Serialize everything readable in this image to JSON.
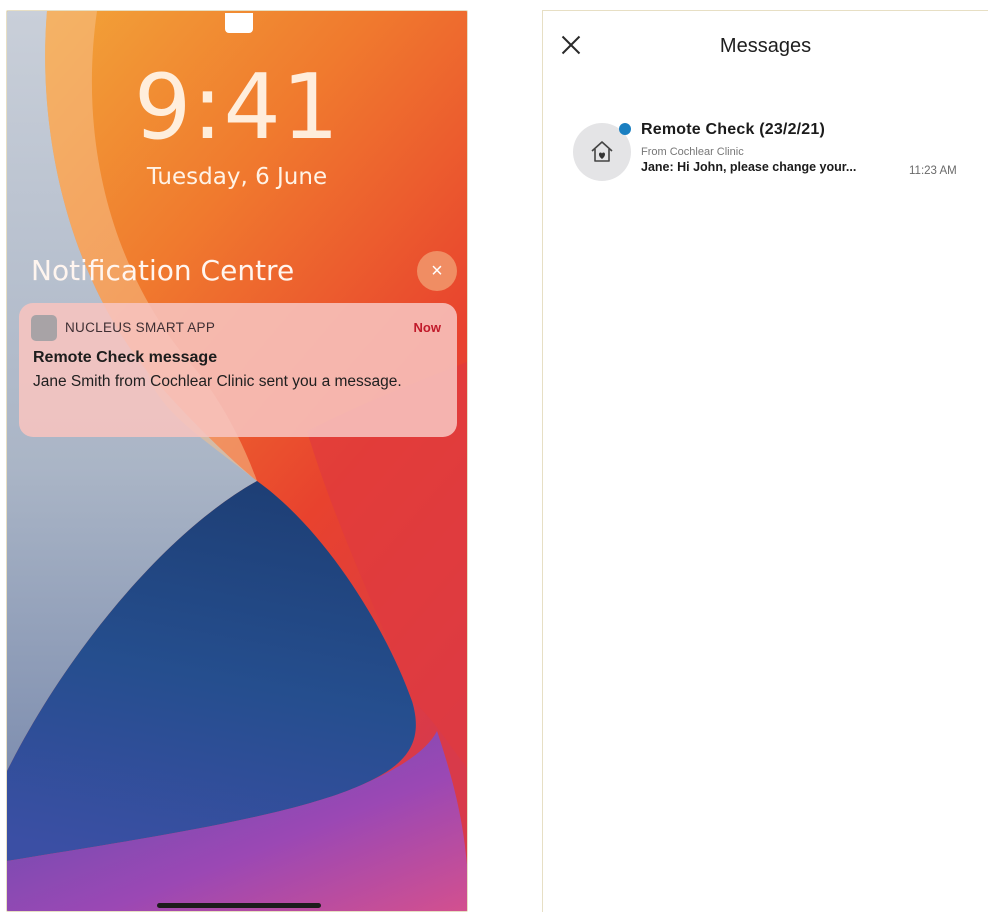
{
  "lock_screen": {
    "time": "9:41",
    "date": "Tuesday, 6 June",
    "notification_centre_title": "Notification Centre",
    "close_glyph": "×",
    "notification": {
      "app_name": "NUCLEUS SMART APP",
      "time": "Now",
      "title": "Remote Check message",
      "body": "Jane Smith from Cochlear Clinic sent you a message."
    }
  },
  "messages_screen": {
    "title": "Messages",
    "close_icon": "close-icon",
    "items": [
      {
        "title": "Remote Check (23/2/21)",
        "from": "From Cochlear Clinic",
        "preview": "Jane: Hi John, please change your...",
        "time": "11:23 AM",
        "unread": true,
        "icon": "home-heart-icon"
      }
    ]
  },
  "colors": {
    "unread_dot": "#1a7fc1",
    "notification_time": "#c11a2a",
    "close_button_bg": "#f08d63"
  }
}
